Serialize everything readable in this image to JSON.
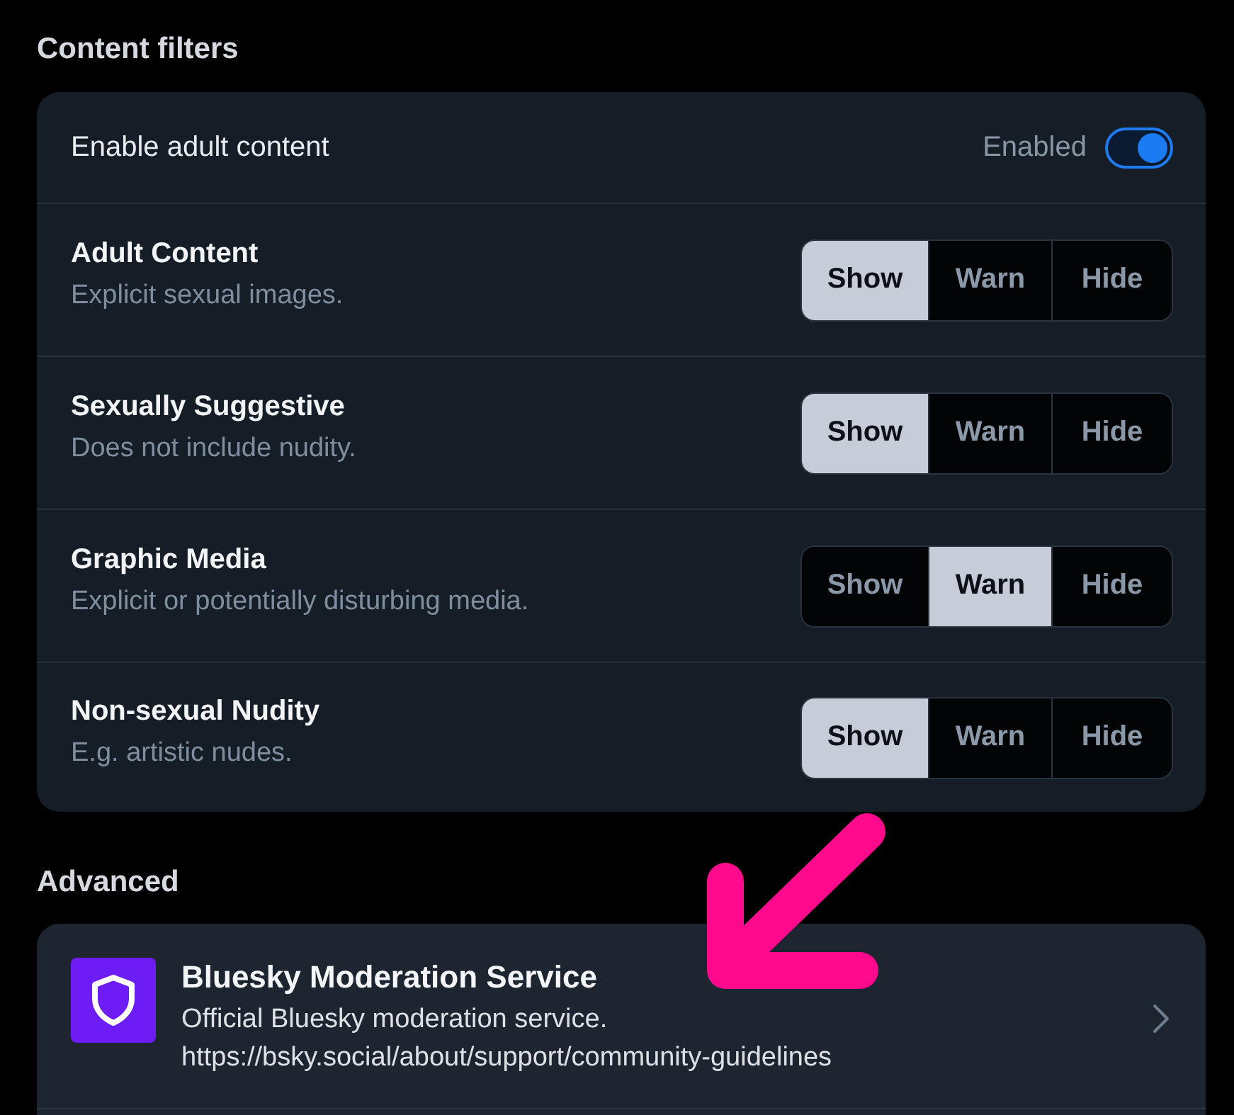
{
  "content_filters": {
    "title": "Content filters",
    "adult_toggle": {
      "label": "Enable adult content",
      "status": "Enabled",
      "on": true
    },
    "filters": [
      {
        "name": "Adult Content",
        "description": "Explicit sexual images.",
        "options": [
          {
            "label": "Show",
            "selected": true
          },
          {
            "label": "Warn",
            "selected": false
          },
          {
            "label": "Hide",
            "selected": false
          }
        ]
      },
      {
        "name": "Sexually Suggestive",
        "description": "Does not include nudity.",
        "options": [
          {
            "label": "Show",
            "selected": true
          },
          {
            "label": "Warn",
            "selected": false
          },
          {
            "label": "Hide",
            "selected": false
          }
        ]
      },
      {
        "name": "Graphic Media",
        "description": "Explicit or potentially disturbing media.",
        "options": [
          {
            "label": "Show",
            "selected": false
          },
          {
            "label": "Warn",
            "selected": true
          },
          {
            "label": "Hide",
            "selected": false
          }
        ]
      },
      {
        "name": "Non-sexual Nudity",
        "description": "E.g. artistic nudes.",
        "options": [
          {
            "label": "Show",
            "selected": true
          },
          {
            "label": "Warn",
            "selected": false
          },
          {
            "label": "Hide",
            "selected": false
          }
        ]
      }
    ]
  },
  "advanced": {
    "title": "Advanced",
    "services": [
      {
        "name": "Bluesky Moderation Service",
        "description": "Official Bluesky moderation service.",
        "url": "https://bsky.social/about/support/community-guidelines"
      }
    ]
  }
}
